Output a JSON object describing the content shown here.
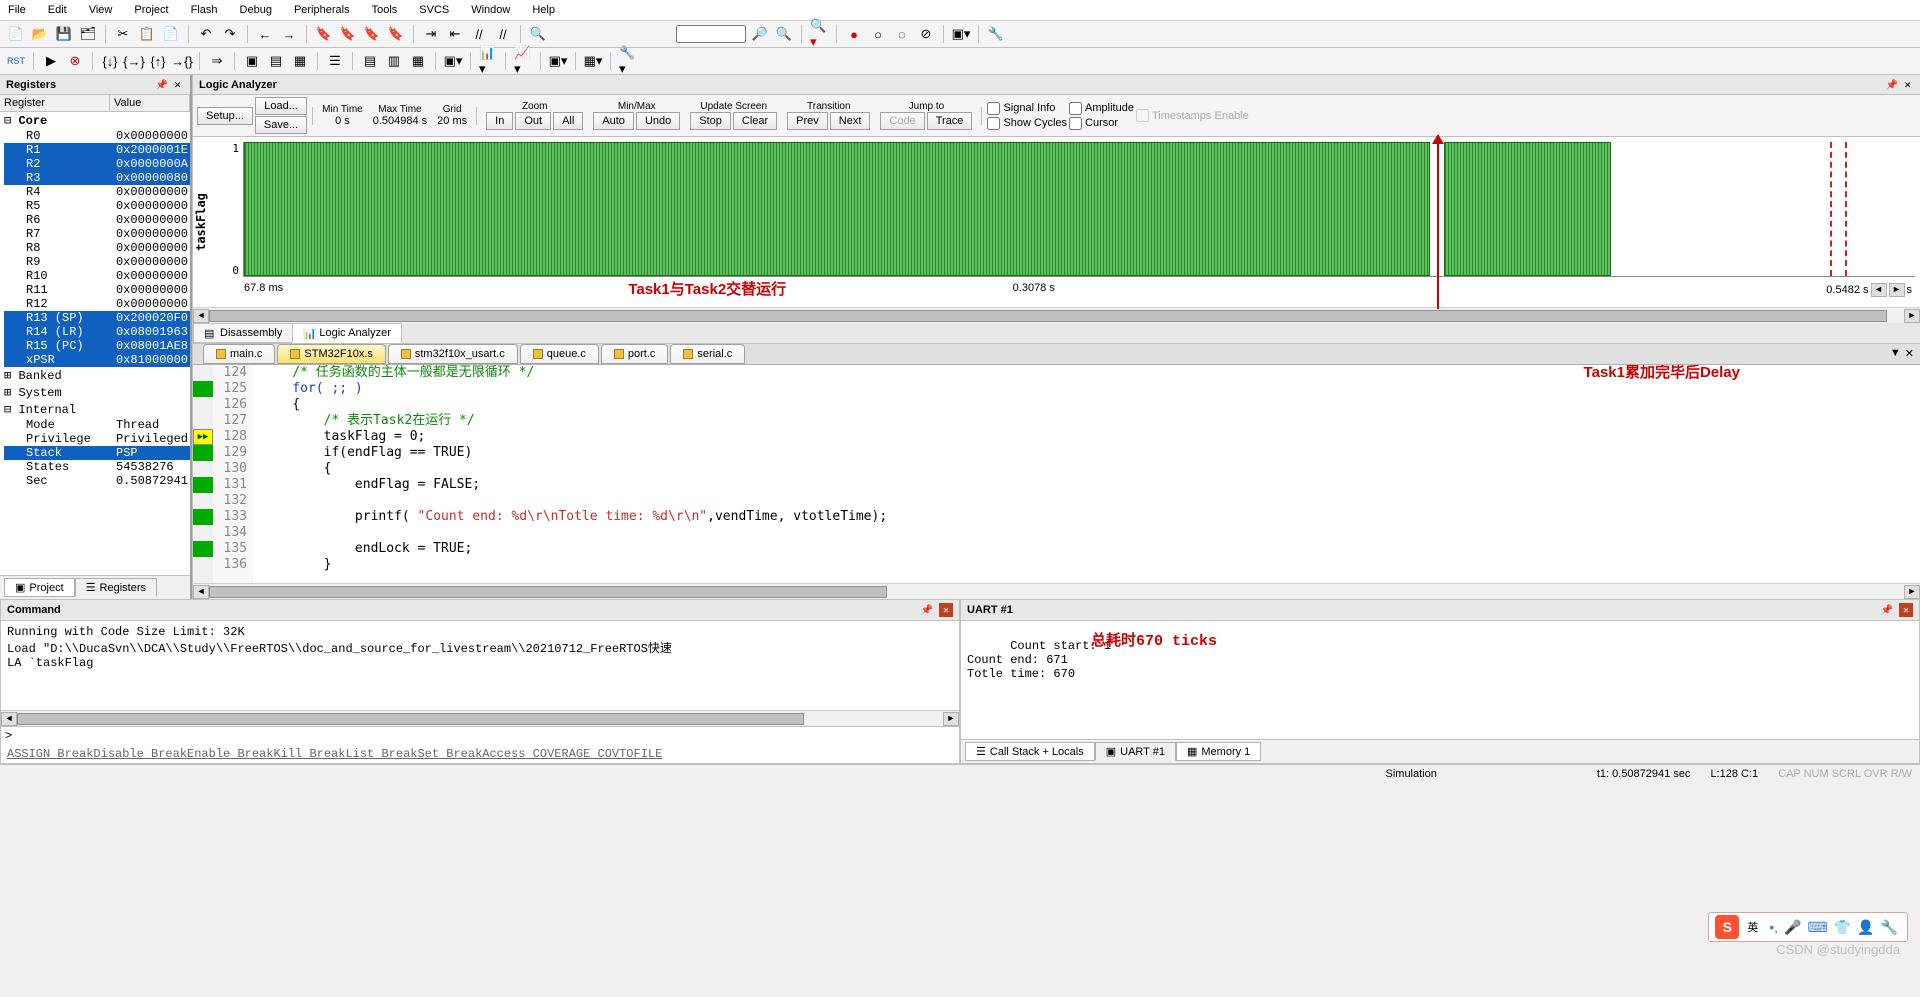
{
  "menu": [
    "File",
    "Edit",
    "View",
    "Project",
    "Flash",
    "Debug",
    "Peripherals",
    "Tools",
    "SVCS",
    "Window",
    "Help"
  ],
  "registers": {
    "title": "Registers",
    "col_name": "Register",
    "col_val": "Value",
    "core": "Core",
    "rows": [
      {
        "n": "R0",
        "v": "0x00000000",
        "sel": false
      },
      {
        "n": "R1",
        "v": "0x2000001E",
        "sel": true
      },
      {
        "n": "R2",
        "v": "0x0000000A",
        "sel": true
      },
      {
        "n": "R3",
        "v": "0x00000080",
        "sel": true
      },
      {
        "n": "R4",
        "v": "0x00000000",
        "sel": false
      },
      {
        "n": "R5",
        "v": "0x00000000",
        "sel": false
      },
      {
        "n": "R6",
        "v": "0x00000000",
        "sel": false
      },
      {
        "n": "R7",
        "v": "0x00000000",
        "sel": false
      },
      {
        "n": "R8",
        "v": "0x00000000",
        "sel": false
      },
      {
        "n": "R9",
        "v": "0x00000000",
        "sel": false
      },
      {
        "n": "R10",
        "v": "0x00000000",
        "sel": false
      },
      {
        "n": "R11",
        "v": "0x00000000",
        "sel": false
      },
      {
        "n": "R12",
        "v": "0x00000000",
        "sel": false
      },
      {
        "n": "R13 (SP)",
        "v": "0x200020F0",
        "sel": true
      },
      {
        "n": "R14 (LR)",
        "v": "0x08001963",
        "sel": true
      },
      {
        "n": "R15 (PC)",
        "v": "0x08001AE8",
        "sel": true
      },
      {
        "n": "xPSR",
        "v": "0x81000000",
        "sel": true
      }
    ],
    "banked": "Banked",
    "system": "System",
    "internal": "Internal",
    "int_rows": [
      {
        "n": "Mode",
        "v": "Thread",
        "sel": false
      },
      {
        "n": "Privilege",
        "v": "Privileged",
        "sel": false
      },
      {
        "n": "Stack",
        "v": "PSP",
        "sel": true
      },
      {
        "n": "States",
        "v": "54538276",
        "sel": false
      },
      {
        "n": "Sec",
        "v": "0.50872941",
        "sel": false
      }
    ]
  },
  "bottom_tabs": {
    "project": "Project",
    "registers": "Registers"
  },
  "logic": {
    "title": "Logic Analyzer",
    "setup": "Setup...",
    "load": "Load...",
    "save": "Save...",
    "min_time_lbl": "Min Time",
    "min_time": "0 s",
    "max_time_lbl": "Max Time",
    "max_time": "0.504984 s",
    "grid_lbl": "Grid",
    "grid": "20 ms",
    "zoom": "Zoom",
    "in": "In",
    "out": "Out",
    "all": "All",
    "minmax": "Min/Max",
    "auto": "Auto",
    "undo": "Undo",
    "update": "Update Screen",
    "stop": "Stop",
    "clear": "Clear",
    "transition": "Transition",
    "prev": "Prev",
    "next": "Next",
    "jump": "Jump to",
    "code": "Code",
    "trace": "Trace",
    "signal": "Signal Info",
    "amp": "Amplitude",
    "ts": "Timestamps Enable",
    "cycles": "Show Cycles",
    "cursor": "Cursor",
    "ylabel": "taskFlag",
    "y1": "1",
    "y0": "0",
    "t_left": "67.8 ms",
    "t_mid": "0.3078 s",
    "t_right": "0.5482 s",
    "t_unit": "s",
    "annot1": "Task1与Task2交替运行",
    "annot2": "Task1累加完毕后Delay",
    "tabs": {
      "disasm": "Disassembly",
      "la": "Logic Analyzer"
    }
  },
  "files": [
    "main.c",
    "STM32F10x.s",
    "stm32f10x_usart.c",
    "queue.c",
    "port.c",
    "serial.c"
  ],
  "code": {
    "lines": [
      {
        "n": 124,
        "g": false,
        "t": "    /* 任务函数的主体一般都是无限循环 */",
        "cls": "c-comment"
      },
      {
        "n": 125,
        "g": true,
        "t": "    for( ;; )",
        "cls": "c-kw"
      },
      {
        "n": 126,
        "g": false,
        "t": "    {"
      },
      {
        "n": 127,
        "g": false,
        "t": "        /* 表示Task2在运行 */",
        "cls": "c-comment"
      },
      {
        "n": 128,
        "g": true,
        "arrow": true,
        "t": "        taskFlag = 0;"
      },
      {
        "n": 129,
        "g": true,
        "t": "        if(endFlag == TRUE)"
      },
      {
        "n": 130,
        "g": false,
        "t": "        {"
      },
      {
        "n": 131,
        "g": true,
        "t": "            endFlag = FALSE;"
      },
      {
        "n": 132,
        "g": false,
        "t": ""
      },
      {
        "n": 133,
        "g": true,
        "str": true,
        "t": "            printf( \"Count end: %d\\r\\nTotle time: %d\\r\\n\",vendTime, vtotleTime);"
      },
      {
        "n": 134,
        "g": false,
        "t": ""
      },
      {
        "n": 135,
        "g": true,
        "t": "            endLock = TRUE;"
      },
      {
        "n": 136,
        "g": false,
        "t": "        }"
      }
    ]
  },
  "command": {
    "title": "Command",
    "body": "Running with Code Size Limit: 32K\nLoad \"D:\\\\DucaSvn\\\\DCA\\\\Study\\\\FreeRTOS\\\\doc_and_source_for_livestream\\\\20210712_FreeRTOS快速\nLA `taskFlag",
    "prompt": ">",
    "links": "ASSIGN BreakDisable BreakEnable BreakKill BreakList BreakSet BreakAccess COVERAGE COVTOFILE"
  },
  "uart": {
    "title": "UART #1",
    "body": "Count start: 1\nCount end: 671\nTotle time: 670",
    "annot": "总耗时670 ticks"
  },
  "lower_tabs": {
    "callstack": "Call Stack + Locals",
    "uart": "UART #1",
    "memory": "Memory 1"
  },
  "status": {
    "sim": "Simulation",
    "t1": "t1: 0.50872941 sec",
    "pos": "L:128 C:1",
    "caps": "CAP  NUM  SCRL  OVR  R/W"
  },
  "watermark": "CSDN @studyingdda",
  "ime": "英"
}
